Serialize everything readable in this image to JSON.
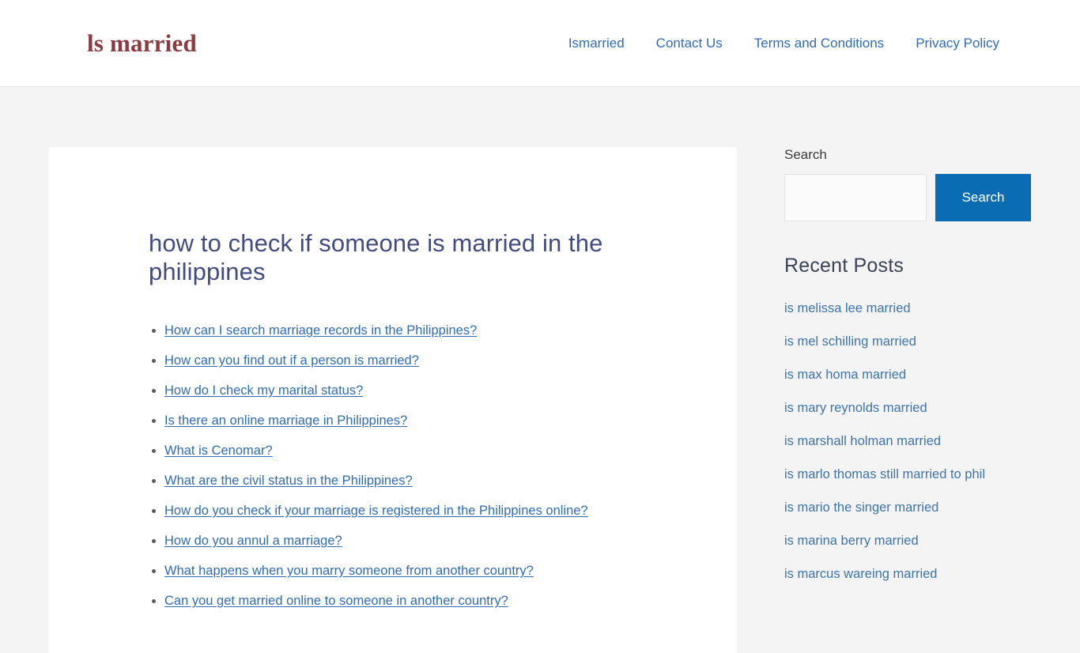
{
  "header": {
    "logo_text": "ls married",
    "nav": [
      {
        "label": "Ismarried"
      },
      {
        "label": "Contact Us"
      },
      {
        "label": "Terms and Conditions"
      },
      {
        "label": "Privacy Policy"
      }
    ]
  },
  "article": {
    "title": "how to check if someone is married in the philippines",
    "toc": [
      {
        "label": "How can I search marriage records in the Philippines?"
      },
      {
        "label": "How can you find out if a person is married?"
      },
      {
        "label": "How do I check my marital status?"
      },
      {
        "label": "Is there an online marriage in Philippines?"
      },
      {
        "label": "What is Cenomar?"
      },
      {
        "label": "What are the civil status in the Philippines?"
      },
      {
        "label": "How do you check if your marriage is registered in the Philippines online?"
      },
      {
        "label": "How do you annul a marriage?"
      },
      {
        "label": "What happens when you marry someone from another country?"
      },
      {
        "label": "Can you get married online to someone in another country?"
      }
    ]
  },
  "sidebar": {
    "search": {
      "label": "Search",
      "value": "",
      "placeholder": "",
      "button_label": "Search"
    },
    "recent_posts": {
      "title": "Recent Posts",
      "items": [
        {
          "label": "is melissa lee married"
        },
        {
          "label": "is mel schilling married"
        },
        {
          "label": "is max homa married"
        },
        {
          "label": "is mary reynolds married"
        },
        {
          "label": "is marshall holman married"
        },
        {
          "label": "is marlo thomas still married to phil"
        },
        {
          "label": "is mario the singer married"
        },
        {
          "label": "is marina berry married"
        },
        {
          "label": "is marcus wareing married"
        }
      ]
    }
  },
  "colors": {
    "logo": "#8c3b40",
    "nav_link": "#2f6cb5",
    "title": "#414d80",
    "toc_link": "#2f6cb5",
    "recent_link": "#3d74ab",
    "search_button": "#0a6cb3",
    "page_background": "#f4f4f4"
  }
}
